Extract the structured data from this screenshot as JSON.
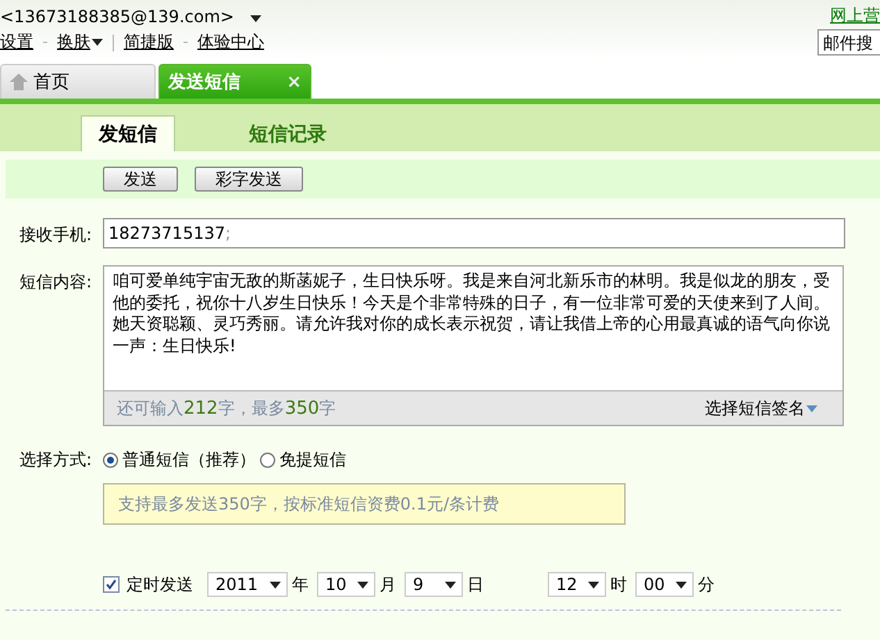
{
  "header": {
    "account": "<13673188385@139.com>",
    "top_right_link": "网上营",
    "links": [
      {
        "label": "设置",
        "dropdown": false
      },
      {
        "label": "换肤",
        "dropdown": true
      },
      {
        "label": "简捷版",
        "dropdown": false
      },
      {
        "label": "体验中心",
        "dropdown": false
      }
    ],
    "search": {
      "placeholder": "邮件搜"
    }
  },
  "tabs": [
    {
      "label": "首页",
      "selected": false,
      "kind": "home"
    },
    {
      "label": "发送短信",
      "selected": true,
      "kind": "closable",
      "close": "×"
    }
  ],
  "subtabs": [
    {
      "label": "发短信",
      "selected": true
    },
    {
      "label": "短信记录",
      "selected": false
    }
  ],
  "toolbar": [
    "发送",
    "彩字发送"
  ],
  "form": {
    "recipient_label": "接收手机:",
    "recipient": "18273715137",
    "recipient_sep": ";",
    "content_label": "短信内容:",
    "content": "咱可爱单纯宇宙无敌的斯菡妮子，生日快乐呀。我是来自河北新乐市的林明。我是似龙的朋友，受他的委托，祝你十八岁生日快乐！今天是个非常特殊的日子，有一位非常可爱的天使来到了人间。她天资聪颖、灵巧秀丽。请允许我对你的成长表示祝贺，请让我借上帝的心用最真诚的语气向你说一声：生日快乐!",
    "counter": "还可输入**212**字，最多**350**字",
    "signature": "选择短信签名"
  },
  "mode": {
    "label": "选择方式:",
    "options": [
      {
        "label": "普通短信（推荐）",
        "selected": true
      },
      {
        "label": "免提短信",
        "selected": false
      }
    ],
    "hint": "支持最多发送350字，按标准短信资费0.1元/条计费"
  },
  "schedule": {
    "label": "定时发送",
    "checked": true,
    "fields": [
      {
        "value": "2011",
        "unit": "年"
      },
      {
        "value": "10",
        "unit": "月"
      },
      {
        "value": "9",
        "unit": "日"
      },
      {
        "value": "12",
        "unit": "时"
      },
      {
        "value": "00",
        "unit": "分"
      }
    ]
  }
}
